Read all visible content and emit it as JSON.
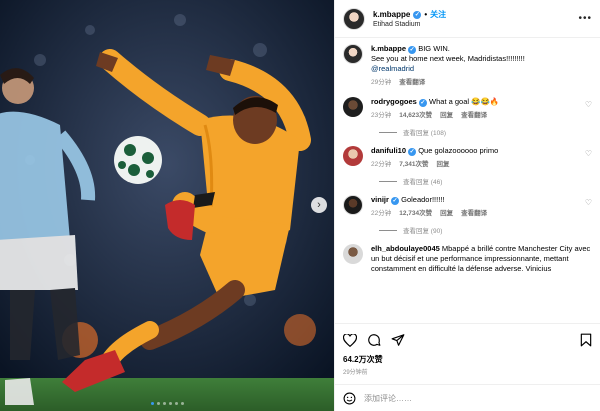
{
  "post": {
    "username": "k.mbappe",
    "follow_label": "关注",
    "location": "Etihad Stadium",
    "more_label": "•••",
    "carousel_next": "›"
  },
  "caption": {
    "username": "k.mbappe",
    "text_line1": "BIG WIN.",
    "text_line2": "See you at home next week, Madridistas!!!!!!!!!",
    "mention": "@realmadrid",
    "time": "29分钟",
    "translate": "查看翻译"
  },
  "comments": [
    {
      "username": "rodrygogoes",
      "text": "What a goal 😂😂🔥",
      "time": "23分钟",
      "likes": "14,623次赞",
      "reply": "回复",
      "translate": "查看翻译",
      "replies": "查看回复 (108)"
    },
    {
      "username": "danifuli10",
      "text": "Que golazoooooo primo",
      "time": "22分钟",
      "likes": "7,341次赞",
      "reply": "回复",
      "translate": "",
      "replies": "查看回复 (46)"
    },
    {
      "username": "vinijr",
      "text": "Goleador!!!!!!",
      "time": "22分钟",
      "likes": "12,734次赞",
      "reply": "回复",
      "translate": "查看翻译",
      "replies": "查看回复 (90)"
    },
    {
      "username": "elh_abdoulaye0045",
      "text": "Mbappé a brillé contre Manchester City avec un but décisif et une performance impressionnante, mettant constamment en difficulté la défense adverse. Vinicius",
      "time": "",
      "likes": "",
      "reply": "",
      "translate": "",
      "replies": ""
    }
  ],
  "footer": {
    "likes": "64.2万次赞",
    "time": "29分钟前",
    "add_comment_placeholder": "添加评论……"
  },
  "colors": {
    "accent": "#0095f6",
    "verified": "#3897f0"
  }
}
